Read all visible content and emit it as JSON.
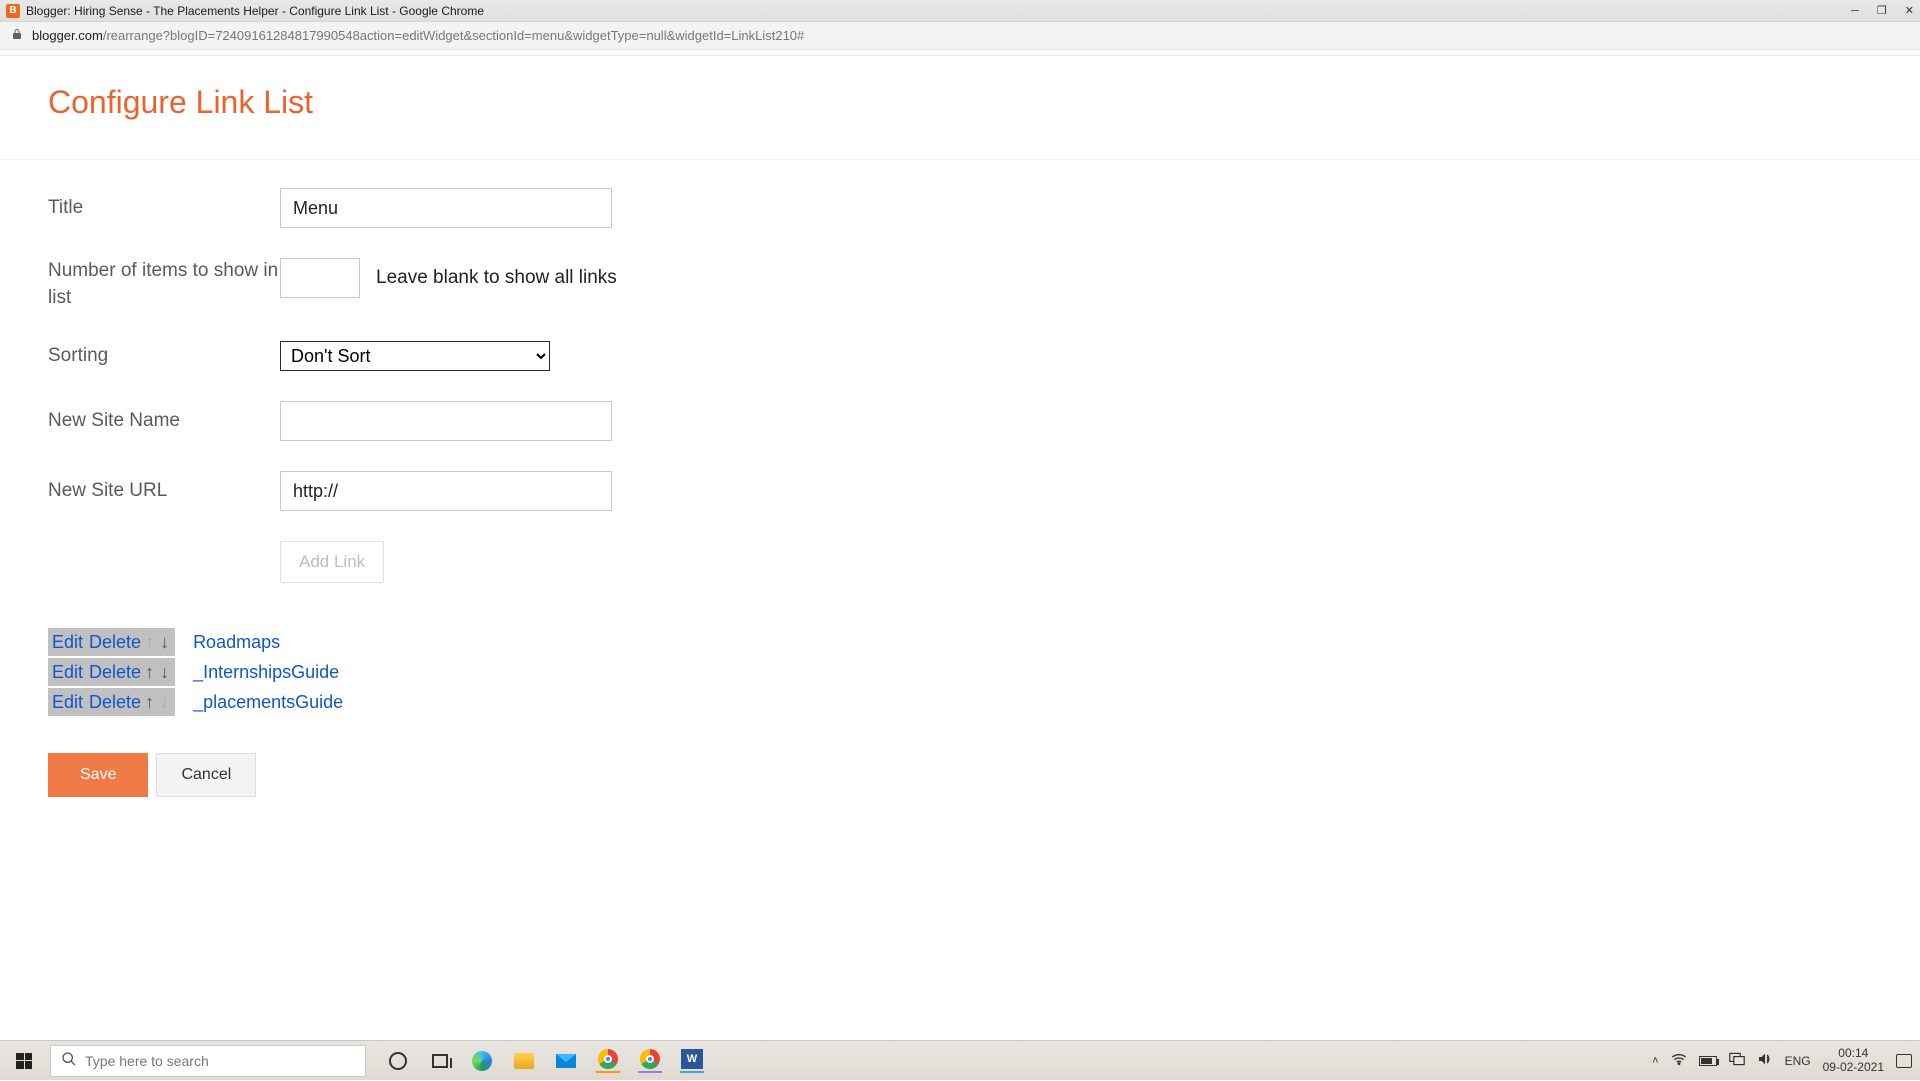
{
  "window": {
    "title": "Blogger: Hiring Sense - The Placements Helper - Configure Link List - Google Chrome",
    "favicon_letter": "B"
  },
  "address": {
    "host": "blogger.com",
    "path": "/rearrange?blogID=72409161284817990548action=editWidget&sectionId=menu&widgetType=null&widgetId=LinkList210#"
  },
  "page": {
    "heading": "Configure Link List"
  },
  "form": {
    "title_label": "Title",
    "title_value": "Menu",
    "num_label": "Number of items to show in list",
    "num_value": "",
    "num_hint": "Leave blank to show all links",
    "sorting_label": "Sorting",
    "sorting_value": "Don't Sort",
    "site_name_label": "New Site Name",
    "site_name_value": "",
    "site_url_label": "New Site URL",
    "site_url_value": "http://",
    "add_link_label": "Add Link"
  },
  "link_actions": {
    "edit": "Edit",
    "delete": "Delete"
  },
  "links": [
    {
      "name": "Roadmaps",
      "up_disabled": true,
      "down_disabled": false
    },
    {
      "name": "_InternshipsGuide",
      "up_disabled": false,
      "down_disabled": false
    },
    {
      "name": "_placementsGuide",
      "up_disabled": false,
      "down_disabled": true
    }
  ],
  "buttons": {
    "save": "Save",
    "cancel": "Cancel"
  },
  "taskbar": {
    "search_placeholder": "Type here to search",
    "lang": "ENG",
    "time": "00:14",
    "date": "09-02-2021"
  }
}
